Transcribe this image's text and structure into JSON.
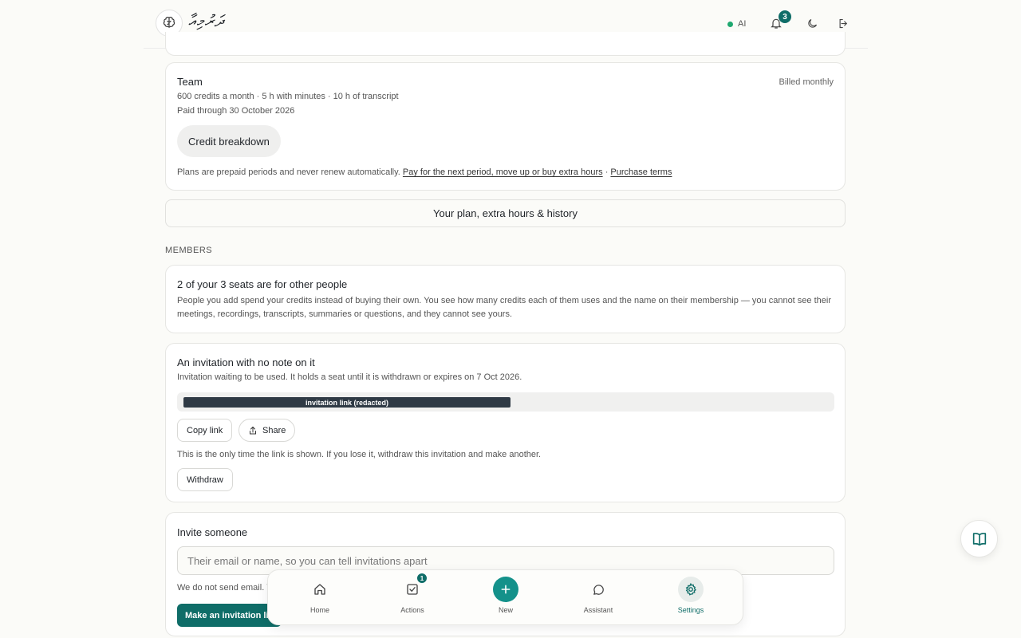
{
  "header": {
    "logo_text": "ދަރުމިއާ",
    "ai_label": "AI",
    "notifications_count": "3",
    "icons": [
      "brain-logo-icon",
      "bell-icon",
      "moon-icon",
      "logout-icon"
    ]
  },
  "plan": {
    "name": "Team",
    "billing": "Billed monthly",
    "details": "600 credits a month · 5 h with minutes · 10 h of transcript",
    "paid_through": "Paid through 30 October 2026",
    "breakdown_button": "Credit breakdown",
    "footnote": "Plans are prepaid periods and never renew automatically.",
    "renew_link": "Pay for the next period, move up or buy extra hours",
    "separator": "·",
    "terms_link": "Purchase terms"
  },
  "plan_history_button": "Your plan, extra hours & history",
  "members": {
    "section_label": "MEMBERS",
    "seats_title": "2 of your 3 seats are for other people",
    "seats_body": "People you add spend your credits instead of buying their own. You see how many credits each of them uses and the name on their membership — you cannot see their meetings, recordings, transcripts, summaries or questions, and they cannot see yours."
  },
  "invitation": {
    "title": "An invitation with no note on it",
    "status": "Invitation waiting to be used. It holds a seat until it is withdrawn or expires on 7 Oct 2026.",
    "link_text": "invitation link (redacted)",
    "copy_button": "Copy link",
    "share_button": "Share",
    "warning": "This is the only time the link is shown. If you lose it, withdraw this invitation and make another.",
    "withdraw_button": "Withdraw"
  },
  "invite_form": {
    "title": "Invite someone",
    "placeholder": "Their email or name, so you can tell invitations apart",
    "note": "We do not send email. Y",
    "submit_button": "Make an invitation lin"
  },
  "bottom_nav": {
    "items": [
      {
        "label": "Home",
        "icon": "home-icon"
      },
      {
        "label": "Actions",
        "icon": "checklist-icon",
        "badge": "1"
      },
      {
        "label": "New",
        "icon": "plus-icon"
      },
      {
        "label": "Assistant",
        "icon": "chat-bubble-icon"
      },
      {
        "label": "Settings",
        "icon": "gear-icon",
        "active": true
      }
    ]
  },
  "colors": {
    "accent": "#0f6d68",
    "accent_light": "#14918a",
    "status_green": "#1fa870",
    "background": "#fbfbf8"
  }
}
